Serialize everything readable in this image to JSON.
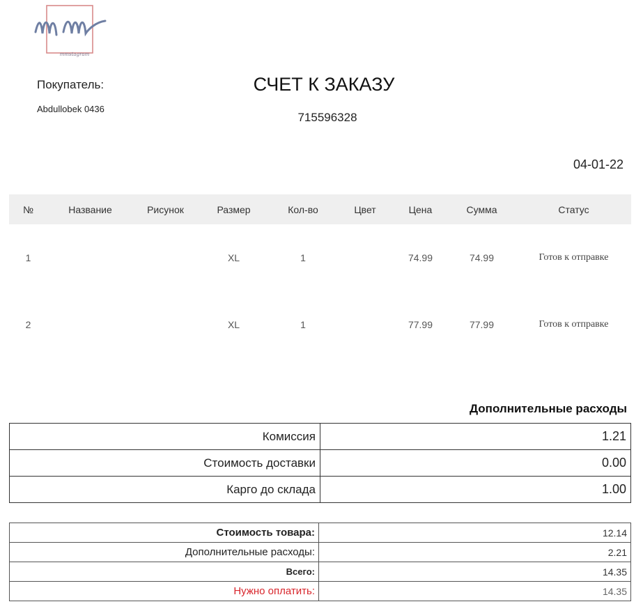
{
  "logo": {
    "name": "mm-logo",
    "caption": "mmstagram"
  },
  "buyer": {
    "label": "Покупатель:",
    "name": "Abdullobek 0436"
  },
  "document": {
    "title": "СЧЕТ К ЗАКАЗУ",
    "order_number": "715596328",
    "date": "04-01-22"
  },
  "items_table": {
    "headers": [
      "№",
      "Название",
      "Рисунок",
      "Размер",
      "Кол-во",
      "Цвет",
      "Цена",
      "Сумма",
      "Статус"
    ],
    "rows": [
      {
        "num": "1",
        "name": "",
        "picture": "",
        "size": "XL",
        "qty": "1",
        "color": "",
        "price": "74.99",
        "sum": "74.99",
        "status": "Готов к отправке"
      },
      {
        "num": "2",
        "name": "",
        "picture": "",
        "size": "XL",
        "qty": "1",
        "color": "",
        "price": "77.99",
        "sum": "77.99",
        "status": "Готов к отправке"
      }
    ]
  },
  "extra_costs": {
    "title": "Дополнительные расходы",
    "rows": [
      {
        "label": "Комиссия",
        "value": "1.21"
      },
      {
        "label": "Стоимость доставки",
        "value": "0.00"
      },
      {
        "label": "Карго до склада",
        "value": "1.00"
      }
    ]
  },
  "totals": {
    "rows": [
      {
        "label": "Стоимость товара:",
        "value": "12.14"
      },
      {
        "label": "Дополнительные расходы:",
        "value": "2.21"
      },
      {
        "label": "Всего:",
        "value": "14.35"
      },
      {
        "label": "Нужно оплатить:",
        "value": "14.35"
      }
    ]
  },
  "colors": {
    "header_bg": "#efefef",
    "pay_label": "#d8262c",
    "logo_frame": "#d98a8a",
    "logo_ink": "#6f7fa3"
  }
}
